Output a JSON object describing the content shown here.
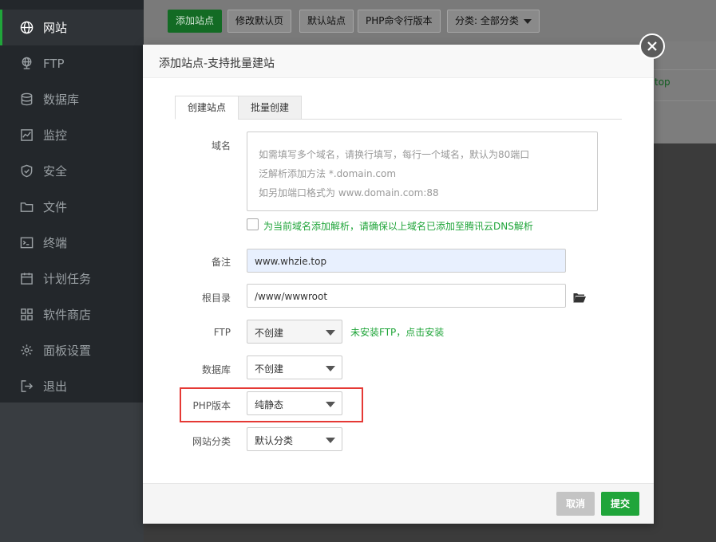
{
  "sidebar": {
    "items": [
      {
        "label": "网站",
        "icon": "globe-icon",
        "active": true
      },
      {
        "label": "FTP",
        "icon": "ftp-globe-icon"
      },
      {
        "label": "数据库",
        "icon": "database-icon"
      },
      {
        "label": "监控",
        "icon": "monitor-chart-icon"
      },
      {
        "label": "安全",
        "icon": "shield-icon"
      },
      {
        "label": "文件",
        "icon": "folder-icon"
      },
      {
        "label": "终端",
        "icon": "terminal-icon"
      },
      {
        "label": "计划任务",
        "icon": "calendar-icon"
      },
      {
        "label": "软件商店",
        "icon": "grid-apps-icon"
      },
      {
        "label": "面板设置",
        "icon": "gear-icon"
      },
      {
        "label": "退出",
        "icon": "logout-icon"
      }
    ]
  },
  "toolbar": {
    "add_site": "添加站点",
    "modify_default_page": "修改默认页",
    "default_site": "默认站点",
    "php_cli_version": "PHP命令行版本",
    "category_select": "分类: 全部分类"
  },
  "background": {
    "partial_link": "top"
  },
  "modal": {
    "title": "添加站点-支持批量建站",
    "tabs": [
      "创建站点",
      "批量创建"
    ],
    "domain": {
      "label": "域名",
      "placeholder_lines": [
        "如需填写多个域名，请换行填写，每行一个域名，默认为80端口",
        "泛解析添加方法 *.domain.com",
        "如另加端口格式为 www.domain.com:88"
      ]
    },
    "dns_checkbox_label": "为当前域名添加解析，请确保以上域名已添加至腾讯云DNS解析",
    "remark": {
      "label": "备注",
      "value": "www.whzie.top"
    },
    "root_dir": {
      "label": "根目录",
      "value": "/www/wwwroot"
    },
    "ftp": {
      "label": "FTP",
      "value": "不创建",
      "hint": "未安装FTP，点击安装"
    },
    "database": {
      "label": "数据库",
      "value": "不创建"
    },
    "php_version": {
      "label": "PHP版本",
      "value": "纯静态"
    },
    "site_category": {
      "label": "网站分类",
      "value": "默认分类"
    },
    "cancel": "取消",
    "submit": "提交"
  },
  "colors": {
    "accent_green": "#20a53a",
    "highlight_red": "#e53935",
    "sidebar_bg": "#23272b"
  }
}
